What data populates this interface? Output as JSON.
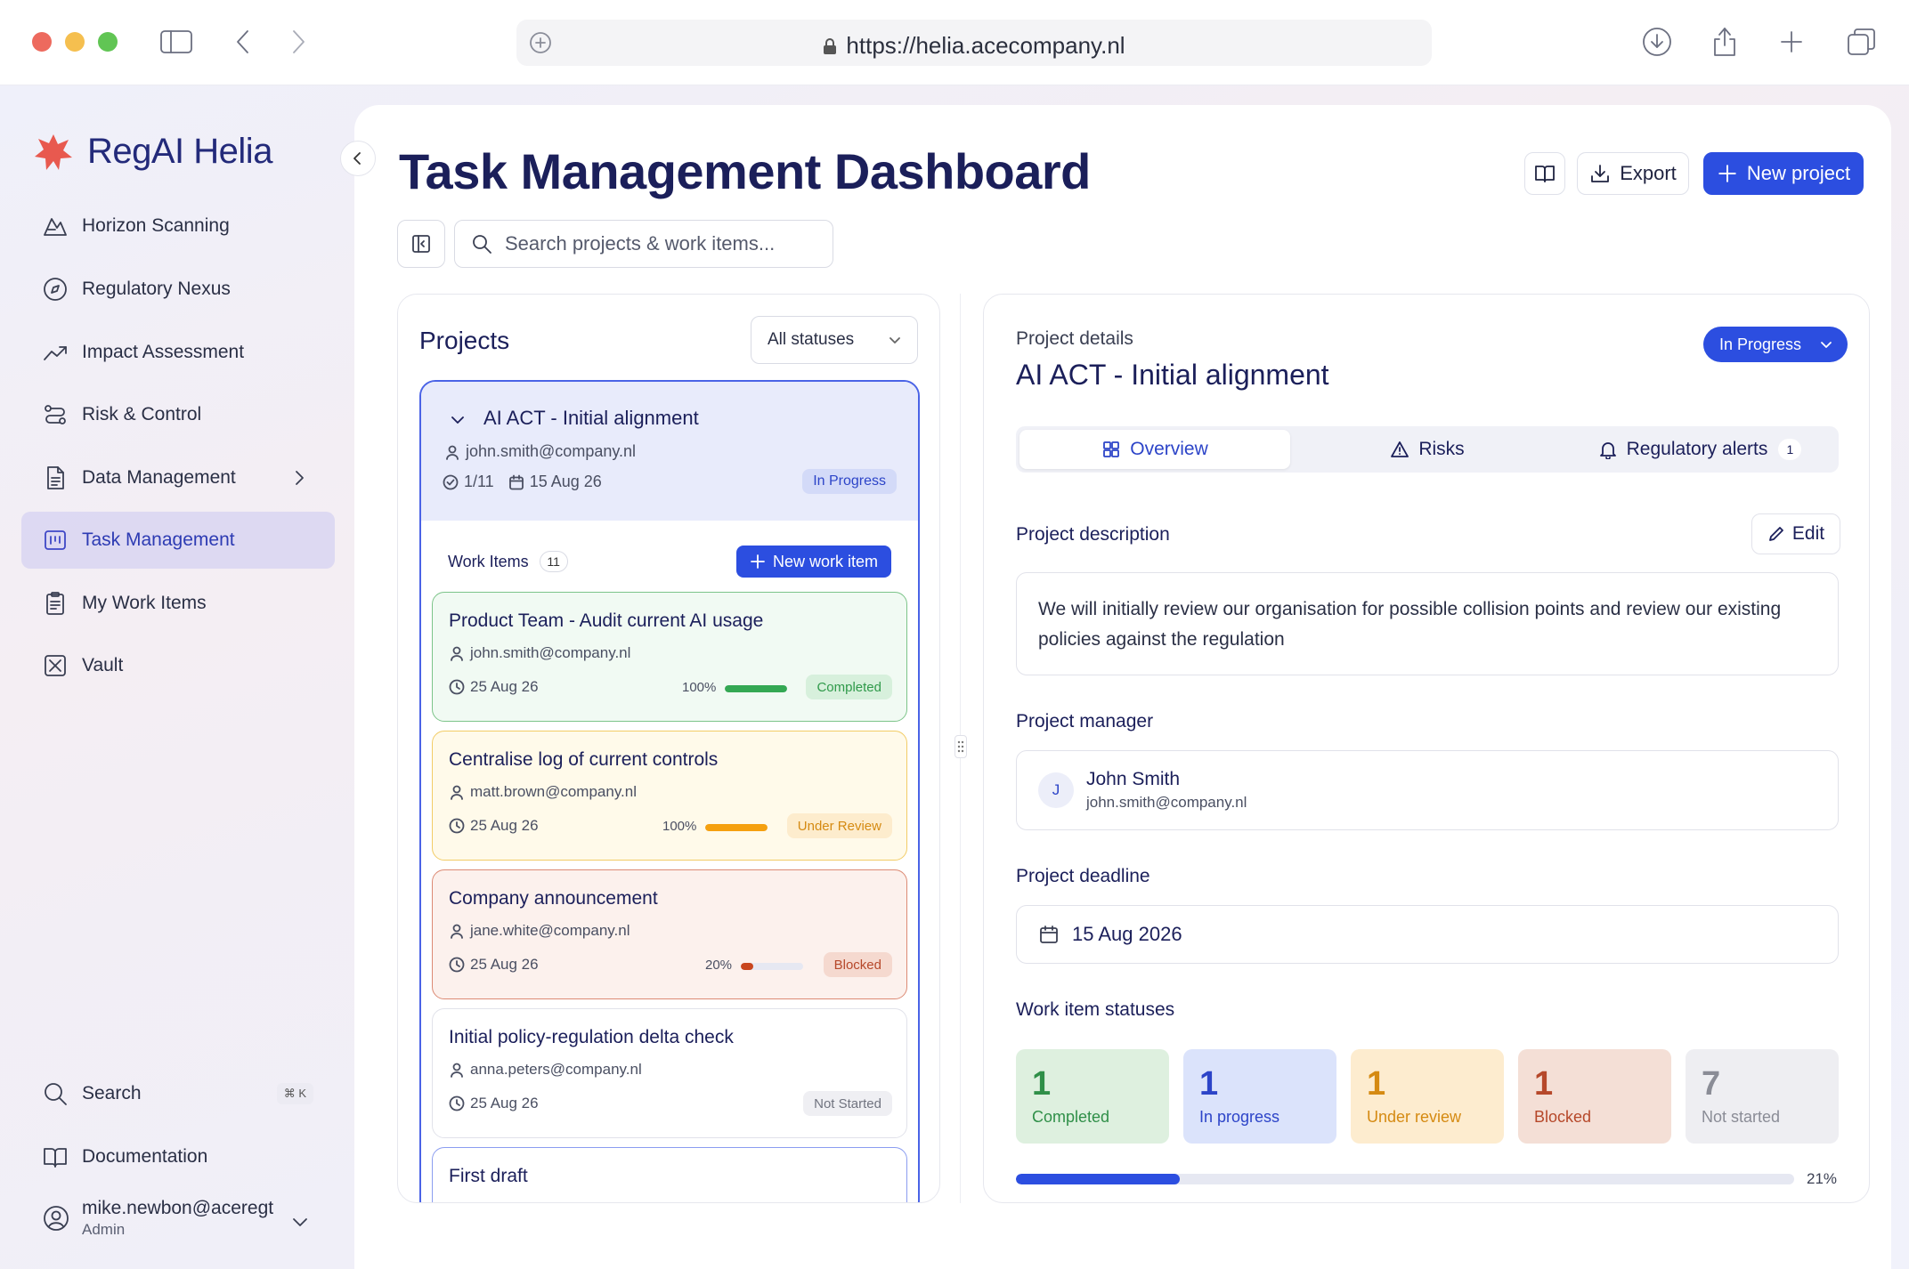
{
  "browser": {
    "url": "https://helia.acecompany.nl"
  },
  "brand": {
    "name": "RegAI Helia",
    "logo_color": "#e8594f"
  },
  "sidebar": {
    "items": [
      {
        "label": "Horizon Scanning",
        "icon": "mountain-icon"
      },
      {
        "label": "Regulatory Nexus",
        "icon": "compass-icon"
      },
      {
        "label": "Impact Assessment",
        "icon": "trend-up-icon"
      },
      {
        "label": "Risk & Control",
        "icon": "route-icon"
      },
      {
        "label": "Data Management",
        "icon": "document-icon"
      },
      {
        "label": "Task Management",
        "icon": "kanban-icon"
      },
      {
        "label": "My Work Items",
        "icon": "clipboard-icon"
      },
      {
        "label": "Vault",
        "icon": "vault-icon"
      }
    ],
    "active": "Task Management",
    "search_label": "Search",
    "search_shortcut": "⌘ K",
    "documentation_label": "Documentation",
    "user": {
      "email": "mike.newbon@aceregt",
      "role": "Admin"
    }
  },
  "header": {
    "title": "Task Management Dashboard",
    "export_label": "Export",
    "new_project_label": "New project",
    "search_placeholder": "Search projects & work items..."
  },
  "projects": {
    "heading": "Projects",
    "filter_value": "All statuses",
    "selected": {
      "title": "AI ACT - Initial alignment",
      "owner": "john.smith@company.nl",
      "progress": "1/11",
      "deadline": "15 Aug 26",
      "status": "In Progress"
    },
    "work_items_label": "Work Items",
    "work_items_count": "11",
    "new_work_item_label": "New work item",
    "work_items": [
      {
        "title": "Product Team - Audit current AI usage",
        "owner": "john.smith@company.nl",
        "date": "25 Aug 26",
        "percent_label": "100%",
        "progress": 1.0,
        "status": "Completed"
      },
      {
        "title": "Centralise log of current controls",
        "owner": "matt.brown@company.nl",
        "date": "25 Aug 26",
        "percent_label": "100%",
        "progress": 1.0,
        "status": "Under Review"
      },
      {
        "title": "Company announcement",
        "owner": "jane.white@company.nl",
        "date": "25 Aug 26",
        "percent_label": "20%",
        "progress": 0.2,
        "status": "Blocked"
      },
      {
        "title": "Initial policy-regulation delta check",
        "owner": "anna.peters@company.nl",
        "date": "25 Aug 26",
        "status": "Not Started"
      },
      {
        "title": "First draft"
      }
    ]
  },
  "details": {
    "label": "Project details",
    "title": "AI ACT - Initial alignment",
    "status": "In Progress",
    "tabs": [
      {
        "label": "Overview",
        "icon": "grid-icon"
      },
      {
        "label": "Risks",
        "icon": "warning-icon"
      },
      {
        "label": "Regulatory alerts",
        "icon": "bell-icon",
        "count": "1"
      }
    ],
    "description_label": "Project description",
    "edit_label": "Edit",
    "description": "We will initially review our organisation for possible collision points and review our existing policies against the regulation",
    "manager_label": "Project manager",
    "manager": {
      "initial": "J",
      "name": "John Smith",
      "email": "john.smith@company.nl"
    },
    "deadline_label": "Project deadline",
    "deadline": "15 Aug 2026",
    "statuses_label": "Work item statuses",
    "statuses": [
      {
        "count": "1",
        "label": "Completed",
        "bg": "#def0df",
        "color": "#2f8f48"
      },
      {
        "count": "1",
        "label": "In progress",
        "bg": "#dbe3fb",
        "color": "#2c44c8"
      },
      {
        "count": "1",
        "label": "Under review",
        "bg": "#fdeccf",
        "color": "#d58a12"
      },
      {
        "count": "1",
        "label": "Blocked",
        "bg": "#f4dfd6",
        "color": "#b6482a"
      },
      {
        "count": "7",
        "label": "Not started",
        "bg": "#eeeef2",
        "color": "#8a8c96"
      }
    ],
    "overall_progress": 0.21,
    "overall_progress_label": "21%"
  },
  "colors": {
    "accent": "#2c4ee0",
    "completed": "#34a853",
    "review": "#f5a00f",
    "blocked": "#c9461e"
  }
}
